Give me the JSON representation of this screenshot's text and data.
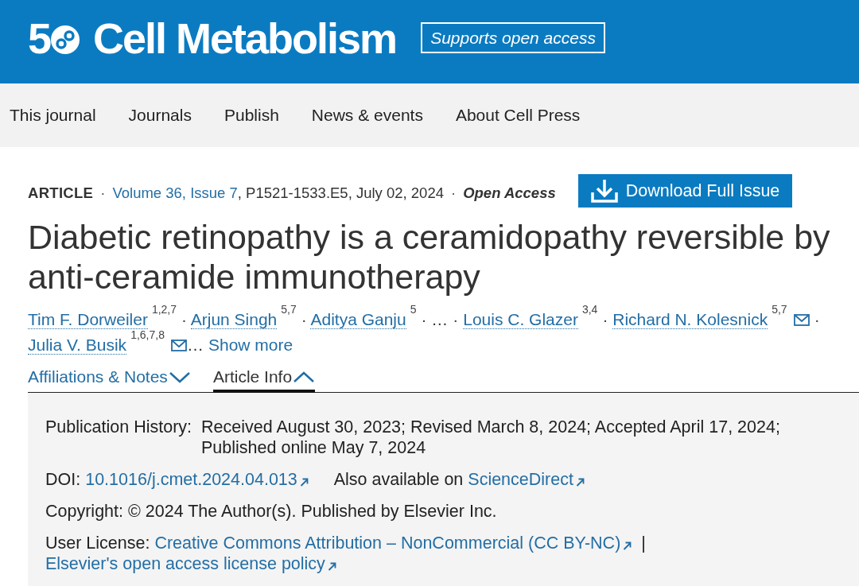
{
  "header": {
    "logo_number": "5",
    "journal_name": "Cell Metabolism",
    "badge": "Supports open access"
  },
  "nav": [
    {
      "label": "This journal"
    },
    {
      "label": "Journals"
    },
    {
      "label": "Publish"
    },
    {
      "label": "News & events"
    },
    {
      "label": "About Cell Press"
    }
  ],
  "article": {
    "meta": [
      {
        "kind": "type",
        "text": "ARTICLE"
      },
      {
        "kind": "separator",
        "text": "·"
      },
      {
        "kind": "link",
        "text": "Volume 36, Issue 7"
      },
      {
        "kind": "plain",
        "text": ", P1521-1533.E5, July 02, 2024"
      },
      {
        "kind": "separator",
        "text": "·"
      },
      {
        "kind": "access",
        "text": "Open Access"
      }
    ],
    "download_button": "Download Full Issue",
    "title": "Diabetic retinopathy is a ceramidopathy reversible by anti-ceramide immunotherapy",
    "authors": [
      {
        "kind": "author",
        "name": "Tim F. Dorweiler",
        "affiliations": "1,2,7",
        "email": false,
        "separator": "·"
      },
      {
        "kind": "author",
        "name": "Arjun Singh",
        "affiliations": "5,7",
        "email": false,
        "separator": "·"
      },
      {
        "kind": "author",
        "name": "Aditya Ganju",
        "affiliations": "5",
        "email": false,
        "separator": "·"
      },
      {
        "kind": "ellipsis",
        "text": "…",
        "separator": "·"
      },
      {
        "kind": "author",
        "name": "Louis C. Glazer",
        "affiliations": "3,4",
        "email": false,
        "separator": "·"
      },
      {
        "kind": "author",
        "name": "Richard N. Kolesnick",
        "affiliations": "5,7",
        "email": true,
        "separator": "·"
      },
      {
        "kind": "author",
        "name": "Julia V. Busik",
        "affiliations": "1,6,7,8",
        "email": true
      }
    ],
    "show_more": {
      "ellipsis": "…",
      "label": "Show more"
    }
  },
  "tabs": [
    {
      "label": "Affiliations & Notes",
      "selected": false,
      "expanded": false
    },
    {
      "label": "Article Info",
      "selected": true,
      "expanded": true
    }
  ],
  "info_panel": {
    "rows": [
      {
        "kind": "hanging",
        "label": "Publication History:",
        "value": "Received August 30, 2023; Revised March 8, 2024; Accepted April 17, 2024; Published online May 7, 2024"
      },
      {
        "kind": "flow",
        "parts": [
          {
            "kind": "label",
            "text": "DOI:"
          },
          {
            "kind": "ext_link",
            "text": "10.1016/j.cmet.2024.04.013"
          },
          {
            "kind": "text",
            "text": "Also available on"
          },
          {
            "kind": "ext_link",
            "text": "ScienceDirect"
          }
        ]
      },
      {
        "kind": "flow",
        "parts": [
          {
            "kind": "text",
            "text": "Copyright: © 2024 The Author(s). Published by Elsevier Inc."
          }
        ]
      },
      {
        "kind": "flow",
        "parts": [
          {
            "kind": "label",
            "text": "User License:"
          },
          {
            "kind": "ext_link",
            "text": "Creative Commons Attribution – NonCommercial (CC BY-NC)"
          },
          {
            "kind": "pipe",
            "text": "|"
          },
          {
            "kind": "ext_link",
            "text": "Elsevier's open access license policy"
          }
        ]
      }
    ]
  }
}
